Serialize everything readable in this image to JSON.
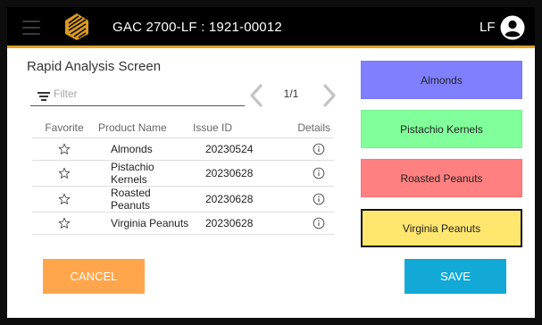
{
  "header": {
    "title": "GAC 2700-LF : 1921-00012",
    "user_initials": "LF",
    "accent_color": "#e2a227",
    "icons": {
      "menu": "hamburger-menu-icon",
      "logo": "gold-logo-icon",
      "avatar": "user-avatar-icon"
    }
  },
  "panel": {
    "title": "Rapid Analysis Screen",
    "filter": {
      "placeholder": "Filter",
      "value": "",
      "icon": "filter-icon"
    },
    "pager": {
      "text": "1/1",
      "prev_icon": "chevron-left-icon",
      "next_icon": "chevron-right-icon"
    }
  },
  "table": {
    "columns": [
      "Favorite",
      "Product Name",
      "Issue ID",
      "Details"
    ],
    "rows": [
      {
        "name": "Almonds",
        "issue_id": "20230524"
      },
      {
        "name": "Pistachio Kernels",
        "issue_id": "20230628"
      },
      {
        "name": "Roasted Peanuts",
        "issue_id": "20230628"
      },
      {
        "name": "Virginia Peanuts",
        "issue_id": "20230628"
      }
    ],
    "favorite_icon": "star-outline-icon",
    "details_icon": "info-icon"
  },
  "product_buttons": [
    {
      "label": "Almonds",
      "color": "#8080ff",
      "selected": false
    },
    {
      "label": "Pistachio Kernels",
      "color": "#80ff9a",
      "selected": false
    },
    {
      "label": "Roasted Peanuts",
      "color": "#ff8080",
      "selected": false
    },
    {
      "label": "Virginia Peanuts",
      "color": "#ffe66e",
      "selected": true
    }
  ],
  "actions": {
    "cancel": {
      "label": "CANCEL",
      "color": "#ffa64d"
    },
    "save": {
      "label": "SAVE",
      "color": "#12a9d7"
    }
  }
}
